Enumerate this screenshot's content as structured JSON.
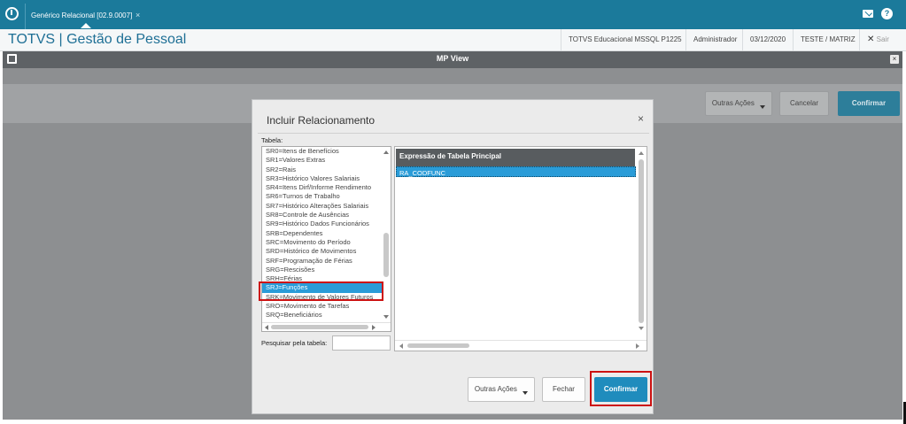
{
  "topbar": {
    "tab_label": "Genérico Relacional [02.9.0007]",
    "tab_close": "×",
    "help_glyph": "?"
  },
  "header": {
    "app_title": "TOTVS | Gestão de Pessoal",
    "environment": "TOTVS Educacional MSSQL P1225",
    "user": "Administrador",
    "date": "03/12/2020",
    "branch": "TESTE / MATRIZ",
    "exit_label": "Sair",
    "exit_glyph": "✕"
  },
  "window": {
    "title": "MP View",
    "close_glyph": "×"
  },
  "background_toolbar": {
    "other_actions": "Outras Ações",
    "cancel": "Cancelar",
    "confirm": "Confirmar"
  },
  "dialog": {
    "title": "Incluir Relacionamento",
    "close_glyph": "×",
    "table_label": "Tabela:",
    "tables": [
      "SR0=Itens de Benefícios",
      "SR1=Valores Extras",
      "SR2=Rais",
      "SR3=Histórico Valores Salariais",
      "SR4=Itens Dirf/Informe Rendimento",
      "SR6=Turnos de Trabalho",
      "SR7=Histórico Alterações Salariais",
      "SR8=Controle de Ausências",
      "SR9=Histórico Dados Funcionários",
      "SRB=Dependentes",
      "SRC=Movimento do Período",
      "SRD=Histórico de Movimentos",
      "SRF=Programação de Férias",
      "SRG=Rescisões",
      "SRH=Férias",
      "SRJ=Funções",
      "SRK=Movimento de Valores Futuros",
      "SRO=Movimento de Tarefas",
      "SRQ=Beneficiários"
    ],
    "selected_table": "SRJ=Funções",
    "grid_header": "Expressão de Tabela Principal",
    "grid_rows": [
      "RA_CODFUNC"
    ],
    "search_label": "Pesquisar pela tabela:",
    "search_value": "",
    "other_actions": "Outras Ações",
    "close_button": "Fechar",
    "confirm_button": "Confirmar"
  },
  "colors": {
    "topbar": "#1b7a9b",
    "accent": "#1f8cbd",
    "selection": "#2a9cd8",
    "highlight": "#cc1111"
  }
}
